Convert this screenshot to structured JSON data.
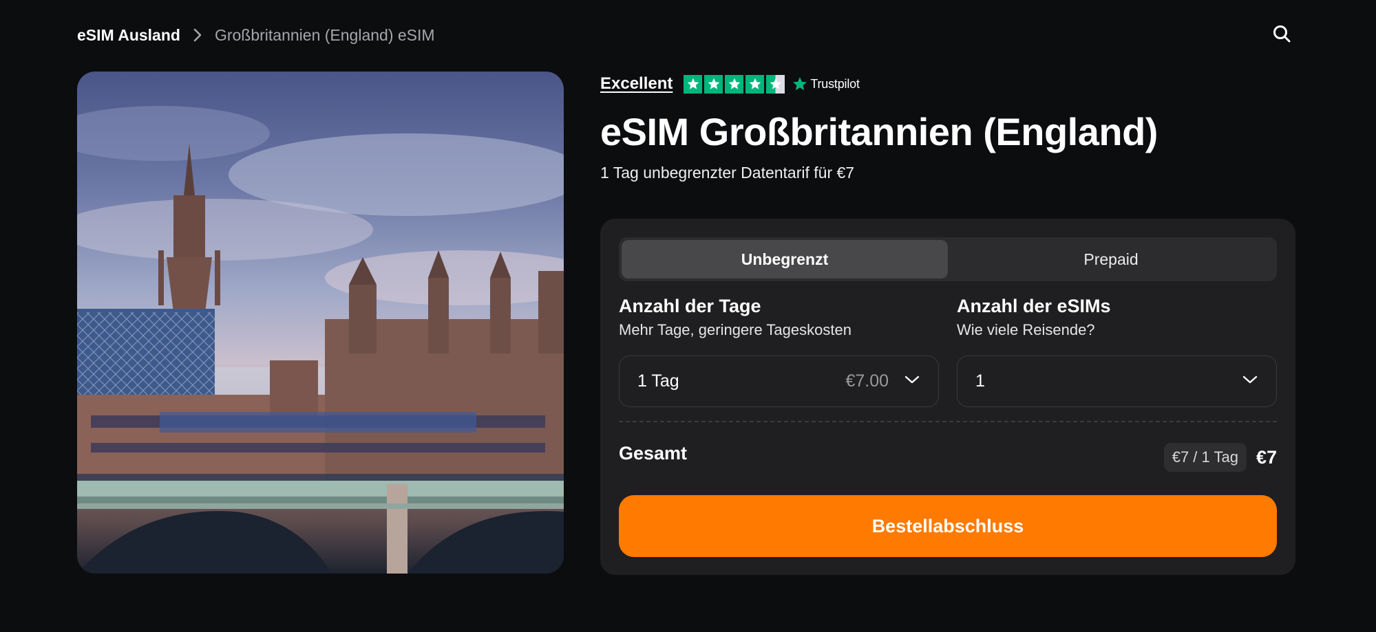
{
  "breadcrumb": {
    "home": "eSIM Ausland",
    "current": "Großbritannien (England) eSIM"
  },
  "header": {
    "search_icon": "search-icon"
  },
  "rating": {
    "label": "Excellent",
    "stars": 4.5,
    "max_stars": 5,
    "provider": "Trustpilot",
    "star_color": "#00b67a"
  },
  "product": {
    "title": "eSIM Großbritannien (England)",
    "subtitle": "1 Tag unbegrenzter Datentarif für €7"
  },
  "plan_tabs": [
    {
      "label": "Unbegrenzt",
      "active": true
    },
    {
      "label": "Prepaid",
      "active": false
    }
  ],
  "days": {
    "title": "Anzahl der Tage",
    "subtitle": "Mehr Tage, geringere Tageskosten",
    "selected": "1 Tag",
    "price": "€7.00"
  },
  "esims": {
    "title": "Anzahl der eSIMs",
    "subtitle": "Wie viele Reisende?",
    "selected": "1"
  },
  "total": {
    "label": "Gesamt",
    "per_day": "€7 / 1 Tag",
    "price": "€7"
  },
  "cta": {
    "label": "Bestellabschluss",
    "color": "#ff7a00"
  },
  "hero_image": "westminster-palace-photo"
}
